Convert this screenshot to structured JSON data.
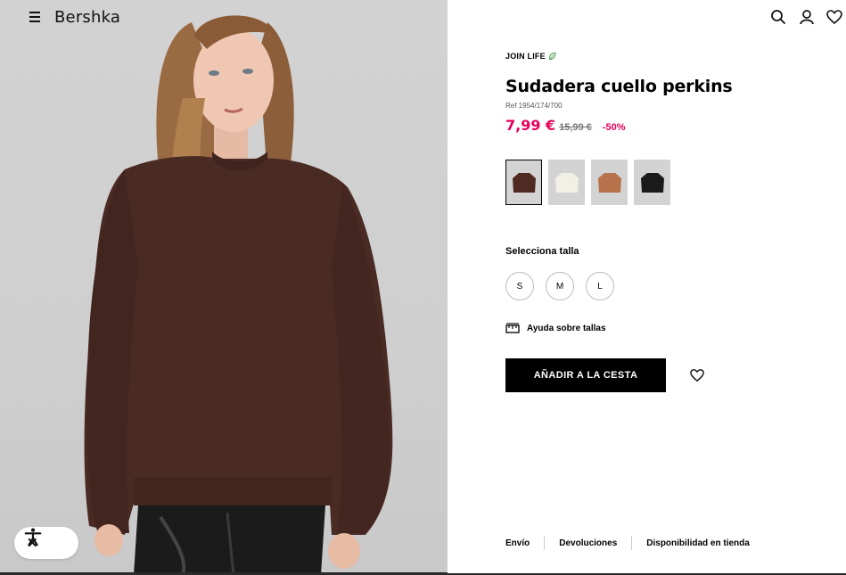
{
  "header": {
    "brand": "Bershka",
    "icons": [
      "menu-icon",
      "search-icon",
      "user-icon",
      "heart-icon"
    ]
  },
  "product": {
    "badge": "JOIN LIFE",
    "name": "Sudadera cuello perkins",
    "ref": "Ref 1954/174/700",
    "price_current": "7,99 €",
    "price_original": "15,99 €",
    "discount": "-50%",
    "colors": [
      {
        "name": "brown",
        "hex": "#4e2a22",
        "selected": true
      },
      {
        "name": "cream",
        "hex": "#f1efe6",
        "selected": false
      },
      {
        "name": "camel",
        "hex": "#b5724b",
        "selected": false
      },
      {
        "name": "black",
        "hex": "#1a1a1a",
        "selected": false
      }
    ],
    "size_label": "Selecciona talla",
    "sizes": [
      "S",
      "M",
      "L"
    ],
    "size_help": "Ayuda sobre tallas",
    "add_to_cart": "AÑADIR A LA CESTA"
  },
  "footer": {
    "links": [
      "Envío",
      "Devoluciones",
      "Disponibilidad en tienda"
    ]
  },
  "colors": {
    "sale": "#e5005b",
    "primary": "#000000",
    "eco_leaf": "#2e8b3d"
  }
}
